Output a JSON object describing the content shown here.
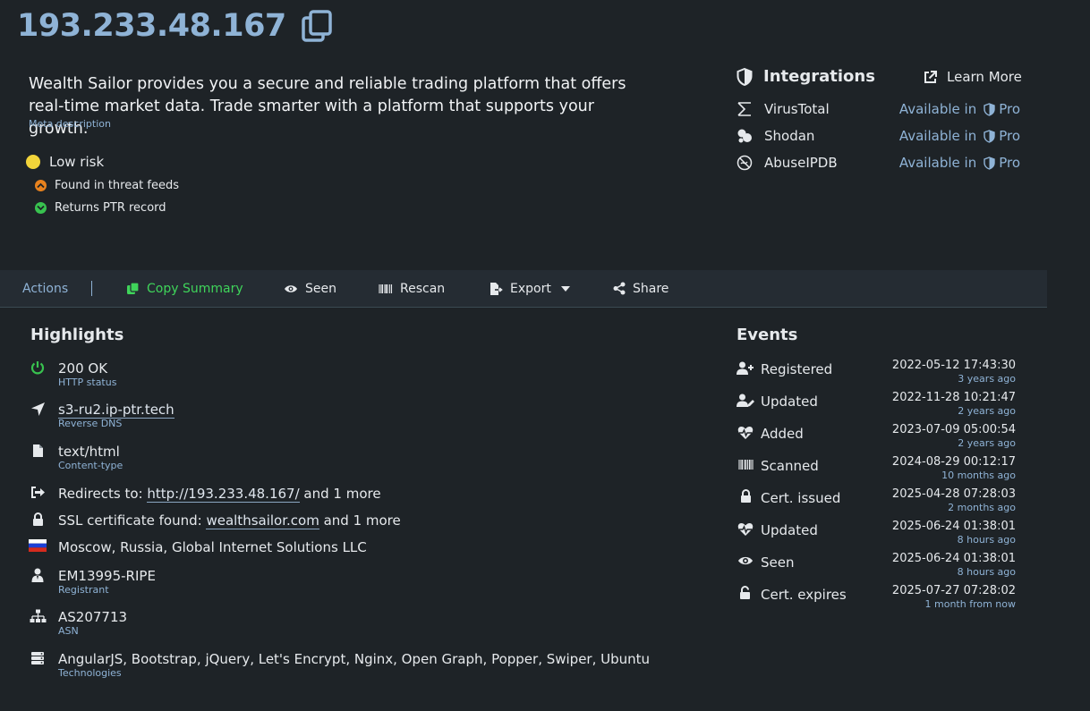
{
  "header": {
    "ip": "193.233.48.167"
  },
  "meta": {
    "description": "Wealth Sailor provides you a secure and reliable trading platform that offers real-time market data. Trade smarter with a platform that supports your growth.",
    "label": "Meta description"
  },
  "risk": {
    "level": "Low risk",
    "level_color": "#f2d43a",
    "items": [
      {
        "text": "Found in threat feeds",
        "icon": "chevron-up-icon",
        "color": "#e8821e"
      },
      {
        "text": "Returns PTR record",
        "icon": "chevron-down-icon",
        "color": "#38c24f"
      }
    ]
  },
  "integrations": {
    "title": "Integrations",
    "learn_more": "Learn More",
    "items": [
      {
        "name": "VirusTotal",
        "icon": "sigma-icon",
        "available": "Available in",
        "tier": "Pro"
      },
      {
        "name": "Shodan",
        "icon": "shodan-icon",
        "available": "Available in",
        "tier": "Pro"
      },
      {
        "name": "AbuseIPDB",
        "icon": "abuseipdb-icon",
        "available": "Available in",
        "tier": "Pro"
      }
    ]
  },
  "actions": {
    "label": "Actions",
    "copy_summary": "Copy Summary",
    "seen": "Seen",
    "rescan": "Rescan",
    "export": "Export",
    "share": "Share",
    "accent": "#3fd45a"
  },
  "highlights": {
    "title": "Highlights",
    "http_status": {
      "value": "200 OK",
      "label": "HTTP status"
    },
    "reverse_dns": {
      "value": "s3-ru2.ip-ptr.tech",
      "label": "Reverse DNS"
    },
    "content_type": {
      "value": "text/html",
      "label": "Content-type"
    },
    "redirects": {
      "prefix": "Redirects to:",
      "link": "http://193.233.48.167/",
      "suffix": "and 1 more"
    },
    "ssl": {
      "prefix": "SSL certificate found:",
      "link": "wealthsailor.com",
      "suffix": "and 1 more"
    },
    "location": {
      "value": "Moscow, Russia, Global Internet Solutions LLC"
    },
    "registrant": {
      "value": "EM13995-RIPE",
      "label": "Registrant"
    },
    "asn": {
      "value": "AS207713",
      "label": "ASN"
    },
    "technologies": {
      "value": "AngularJS, Bootstrap, jQuery, Let's Encrypt, Nginx, Open Graph, Popper, Swiper, Ubuntu",
      "label": "Technologies"
    }
  },
  "events": {
    "title": "Events",
    "items": [
      {
        "label": "Registered",
        "icon": "user-plus-icon",
        "date": "2022-05-12 17:43:30",
        "ago": "3 years ago"
      },
      {
        "label": "Updated",
        "icon": "user-edit-icon",
        "date": "2022-11-28 10:21:47",
        "ago": "2 years ago"
      },
      {
        "label": "Added",
        "icon": "heartbeat-icon",
        "date": "2023-07-09 05:00:54",
        "ago": "2 years ago"
      },
      {
        "label": "Scanned",
        "icon": "barcode-icon",
        "date": "2024-08-29 00:12:17",
        "ago": "10 months ago"
      },
      {
        "label": "Cert. issued",
        "icon": "lock-icon",
        "date": "2025-04-28 07:28:03",
        "ago": "2 months ago"
      },
      {
        "label": "Updated",
        "icon": "heartbeat-icon",
        "date": "2025-06-24 01:38:01",
        "ago": "8 hours ago"
      },
      {
        "label": "Seen",
        "icon": "eye-icon",
        "date": "2025-06-24 01:38:01",
        "ago": "8 hours ago"
      },
      {
        "label": "Cert. expires",
        "icon": "unlock-icon",
        "date": "2025-07-27 07:28:02",
        "ago": "1 month from now"
      }
    ]
  }
}
